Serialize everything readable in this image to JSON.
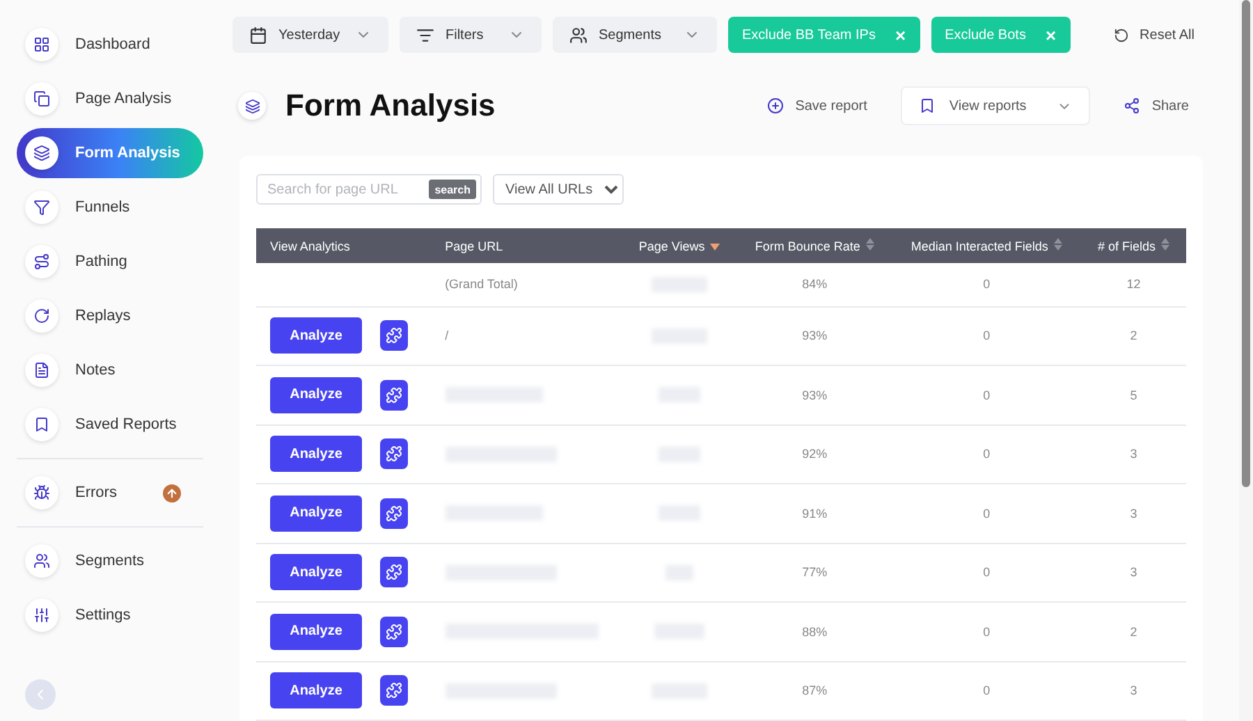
{
  "sidebar": {
    "groups": [
      {
        "items": [
          {
            "label": "Dashboard",
            "selected": false
          },
          {
            "label": "Page Analysis",
            "selected": false
          },
          {
            "label": "Form Analysis",
            "selected": true
          },
          {
            "label": "Funnels",
            "selected": false
          },
          {
            "label": "Pathing",
            "selected": false
          },
          {
            "label": "Replays",
            "selected": false
          },
          {
            "label": "Notes",
            "selected": false
          },
          {
            "label": "Saved Reports",
            "selected": false
          }
        ]
      },
      {
        "items": [
          {
            "label": "Errors",
            "selected": false,
            "upgrade": true
          }
        ]
      },
      {
        "items": [
          {
            "label": "Segments",
            "selected": false
          },
          {
            "label": "Settings",
            "selected": false
          }
        ]
      }
    ]
  },
  "toolbar": {
    "dropdowns": [
      "Yesterday",
      "Filters",
      "Segments"
    ],
    "chips": [
      {
        "label": "Exclude BB Team IPs",
        "close": "×"
      },
      {
        "label": "Exclude Bots",
        "close": "×"
      }
    ],
    "reset": "Reset All"
  },
  "page": {
    "title": "Form Analysis",
    "actions": {
      "save": "Save report",
      "view": "View reports",
      "share": "Share"
    }
  },
  "filter": {
    "placeholder": "Search for page URL",
    "search_button": "search",
    "select": "View All URLs"
  },
  "table": {
    "columns": [
      {
        "label": "View Analytics"
      },
      {
        "label": "Page URL"
      },
      {
        "label": "Page Views",
        "sorted": true
      },
      {
        "label": "Form Bounce Rate",
        "sorted": false
      },
      {
        "label": "Median Interacted Fields",
        "sorted": false
      },
      {
        "label": "# of Fields",
        "sorted": false
      }
    ],
    "total": {
      "label": "(Grand Total)",
      "bounce": "84%",
      "median": "0",
      "fields": "12"
    },
    "rows": [
      {
        "action": "Analyze",
        "url": "/",
        "bounce": "93%",
        "median": "0",
        "fields": "2"
      },
      {
        "action": "Analyze",
        "bounce": "93%",
        "median": "0",
        "fields": "5"
      },
      {
        "action": "Analyze",
        "bounce": "92%",
        "median": "0",
        "fields": "3"
      },
      {
        "action": "Analyze",
        "bounce": "91%",
        "median": "0",
        "fields": "3"
      },
      {
        "action": "Analyze",
        "bounce": "77%",
        "median": "0",
        "fields": "3"
      },
      {
        "action": "Analyze",
        "bounce": "88%",
        "median": "0",
        "fields": "2"
      },
      {
        "action": "Analyze",
        "bounce": "87%",
        "median": "0",
        "fields": "3"
      }
    ]
  }
}
